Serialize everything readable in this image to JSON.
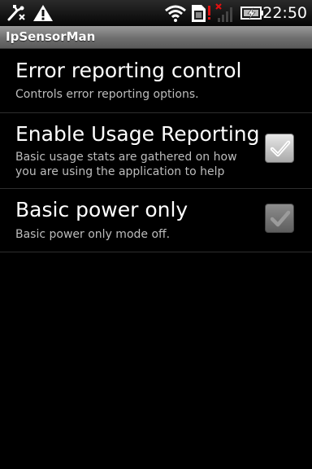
{
  "status_bar": {
    "time": "22:50",
    "icons": [
      "usb-debug-icon",
      "warning-icon",
      "wifi-icon",
      "sim-card-icon",
      "no-signal-icon",
      "battery-charging-icon"
    ]
  },
  "title_bar": {
    "title": "IpSensorMan"
  },
  "preferences": [
    {
      "title": "Error reporting control",
      "summary": "Controls error reporting options."
    },
    {
      "title": "Enable Usage Reporting",
      "summary": "Basic usage stats are gathered on how you are using the application to help",
      "checked": true,
      "enabled": true
    },
    {
      "title": "Basic power only",
      "summary": "Basic power only mode off.",
      "checked": true,
      "enabled": false
    }
  ],
  "colors": {
    "background": "#000000",
    "summary_text": "#bdbdbd",
    "divider": "#2e2e2e"
  }
}
